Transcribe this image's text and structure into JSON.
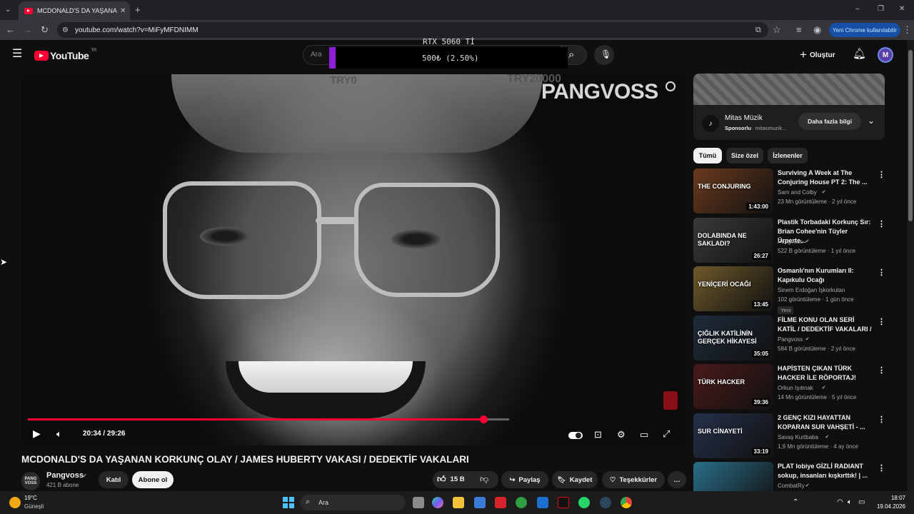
{
  "browser": {
    "tab_title": "MCDONALD'S DA YAŞANAN K",
    "url": "youtube.com/watch?v=MiFyMFDNIMM",
    "new_chrome_label": "Yeni Chrome kullanılabilir",
    "icons": [
      "tab-list-icon",
      "youtube-favicon",
      "close-icon",
      "new-tab-icon",
      "back-icon",
      "forward-icon",
      "reload-icon",
      "site-info-icon",
      "cast-icon",
      "star-icon",
      "media-icon",
      "profile-icon",
      "menu-icon"
    ]
  },
  "youtube": {
    "logo_text": "YouTube",
    "region": "TR",
    "search_placeholder": "Ara",
    "create_label": "Oluştur",
    "avatar_letter": "M"
  },
  "stream_overlay": {
    "goal_title": "RTX 5060 Tİ",
    "goal_progress_text": "500₺ (2.50%)",
    "goal_progress": 0.025,
    "goal_min": "TRY0",
    "goal_max": "TRY20000",
    "bar_color": "#8b1fd8"
  },
  "video": {
    "watermark": "PANGVOSS",
    "time_text": "20:34 / 29:26",
    "played_fraction": 0.6988,
    "buffered_fraction": 1.0,
    "progress_color": "#ff0033",
    "title": "MCDONALD'S DA YAŞANAN KORKUNÇ OLAY / JAMES HUBERTY VAKASI / DEDEKTİF VAKALARI",
    "control_icons": [
      "play-icon",
      "volume-icon",
      "autoplay-toggle",
      "subtitles-icon",
      "settings-icon",
      "theater-icon",
      "fullscreen-icon"
    ]
  },
  "channel": {
    "avatar_text": "PANG VOSS",
    "name": "Pangvoss",
    "subscribers": "421 B abone",
    "join_label": "Katıl",
    "subscribe_label": "Abone ol"
  },
  "actions": {
    "likes": "15 B",
    "share": "Paylaş",
    "save": "Kaydet",
    "thanks": "Teşekkürler"
  },
  "ad": {
    "name": "Mitas Müzik",
    "sponsor_label": "Sponsorlu",
    "domain": "· mitasmuzik...",
    "cta": "Daha fazla bilgi"
  },
  "chips": [
    "Tümü",
    "Size özel",
    "İzlenenler"
  ],
  "recommendations": [
    {
      "title": "Surviving A Week at The Conjuring House PT 2: The ...",
      "channel": "Sam and Colby",
      "verified": true,
      "views": "23 Mn görüntüleme · 2 yıl önce",
      "duration": "1:43:00",
      "thumb_text": "THE CONJURING",
      "thumb_color": "#6b3b1e"
    },
    {
      "title": "Plastik Torbadaki Korkunç Sır: Brian Cohee'nin Tüyler Ürperte...",
      "channel": "Pangvoss",
      "verified": true,
      "views": "522 B görüntüleme · 1 yıl önce",
      "duration": "26:27",
      "thumb_text": "DOLABINDA NE SAKLADI?",
      "thumb_color": "#3a3a3a"
    },
    {
      "title": "Osmanlı'nın Kurumları II: Kapıkulu Ocağı",
      "channel": "Sinem Erdoğan İşkorkutan",
      "verified": false,
      "views": "102 görüntüleme · 1 gün önce",
      "duration": "13:45",
      "badge": "Yeni",
      "thumb_text": "YENİÇERİ OCAĞI",
      "thumb_color": "#6e5a2a"
    },
    {
      "title": "FİLME KONU OLAN SERİ KATİL / DEDEKTİF VAKALARI /",
      "channel": "Pangvoss",
      "verified": true,
      "views": "584 B görüntüleme · 2 yıl önce",
      "duration": "35:05",
      "thumb_text": "ÇIĞLIK KATİLİNİN GERÇEK HİKAYESİ",
      "thumb_color": "#1e2b3a"
    },
    {
      "title": "HAPİSTEN ÇIKAN TÜRK HACKER İLE RÖPORTAJ!",
      "channel": "Orkun Işıtmak",
      "verified": true,
      "views": "14 Mn görüntüleme · 5 yıl önce",
      "duration": "39:36",
      "thumb_text": "TÜRK HACKER",
      "thumb_color": "#4a1a1a"
    },
    {
      "title": "2 GENÇ KIZI HAYATTAN KOPARAN SUR VAHŞETİ - ...",
      "channel": "Savaş Kurtbaba",
      "verified": true,
      "views": "1,9 Mn görüntüleme · 4 ay önce",
      "duration": "33:19",
      "thumb_text": "SUR CİNAYETİ",
      "thumb_color": "#25304a"
    },
    {
      "title": "PLAT lobiye GİZLİ RADIANT sokup, insanları kışkırttık! | ...",
      "channel": "CombatRy",
      "verified": true,
      "views": "",
      "duration": "",
      "thumb_text": "",
      "thumb_color": "#2a6f8a"
    }
  ],
  "taskbar": {
    "temperature": "19°C",
    "weather": "Güneşli",
    "search_placeholder": "Ara",
    "time": "18:07",
    "date": "19.04.2026",
    "app_icons": [
      "windows-start-icon",
      "search-icon",
      "task-view-icon",
      "file-explorer-icon",
      "store-icon",
      "copilot-icon",
      "xbox-icon",
      "outlook-icon",
      "netflix-icon",
      "whatsapp-icon",
      "steam-icon",
      "chrome-icon"
    ]
  }
}
